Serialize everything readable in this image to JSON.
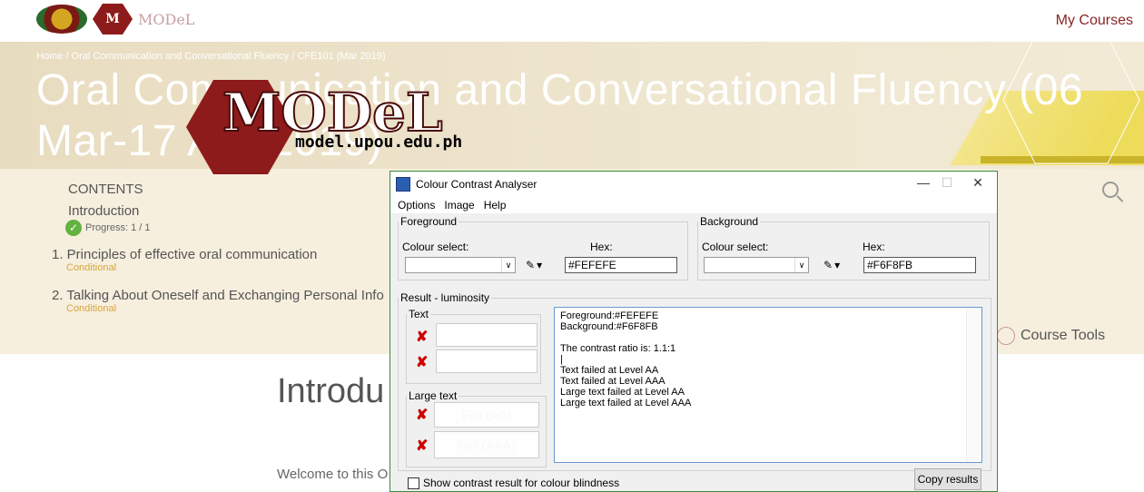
{
  "header": {
    "logo_text": "MODeL",
    "my_courses": "My Courses"
  },
  "breadcrumb": "Home / Oral Communication and Conversational Fluency / CFE101 (Mar 2019)",
  "course_title": "Oral Communication and Conversational Fluency (06 Mar-17 Apr 2019)",
  "overlay_logo": {
    "word": "MODeL",
    "url": "model.upou.edu.ph"
  },
  "sidebar": {
    "contents_label": "CONTENTS",
    "intro_label": "Introduction",
    "progress": "Progress: 1 / 1",
    "items": [
      {
        "label": "1. Principles of effective oral communication",
        "status": "Conditional"
      },
      {
        "label": "2. Talking About Oneself and Exchanging Personal Info",
        "status": "Conditional"
      }
    ],
    "course_tools": "Course Tools"
  },
  "main": {
    "heading": "Introdu",
    "welcome": "Welcome to this O"
  },
  "dialog": {
    "title": "Colour Contrast Analyser",
    "window_buttons": {
      "minimize": "—",
      "maximize": "☐",
      "close": "✕"
    },
    "menu": [
      "Options",
      "Image",
      "Help"
    ],
    "foreground": {
      "legend": "Foreground",
      "colour_select_label": "Colour select:",
      "hex_label": "Hex:",
      "hex_value": "#FEFEFE",
      "color": "#FEFEFE"
    },
    "background": {
      "legend": "Background",
      "colour_select_label": "Colour select:",
      "hex_label": "Hex:",
      "hex_value": "#F6F8FB",
      "color": "#F6F8FB"
    },
    "result": {
      "legend": "Result - luminosity",
      "text_legend": "Text",
      "large_text_legend": "Large text",
      "large_pass_aa": "Fail (AA)",
      "large_pass_aaa": "Fail (AAA)",
      "lines": [
        "Foreground:#FEFEFE",
        "Background:#F6F8FB",
        "",
        "The contrast ratio is: 1.1:1",
        "|",
        "Text failed at Level AA",
        "Text failed at Level AAA",
        "Large text failed at Level AA",
        "Large text failed at Level AAA"
      ]
    },
    "colour_blindness_label": "Show contrast result for colour blindness",
    "copy_button": "Copy results"
  }
}
